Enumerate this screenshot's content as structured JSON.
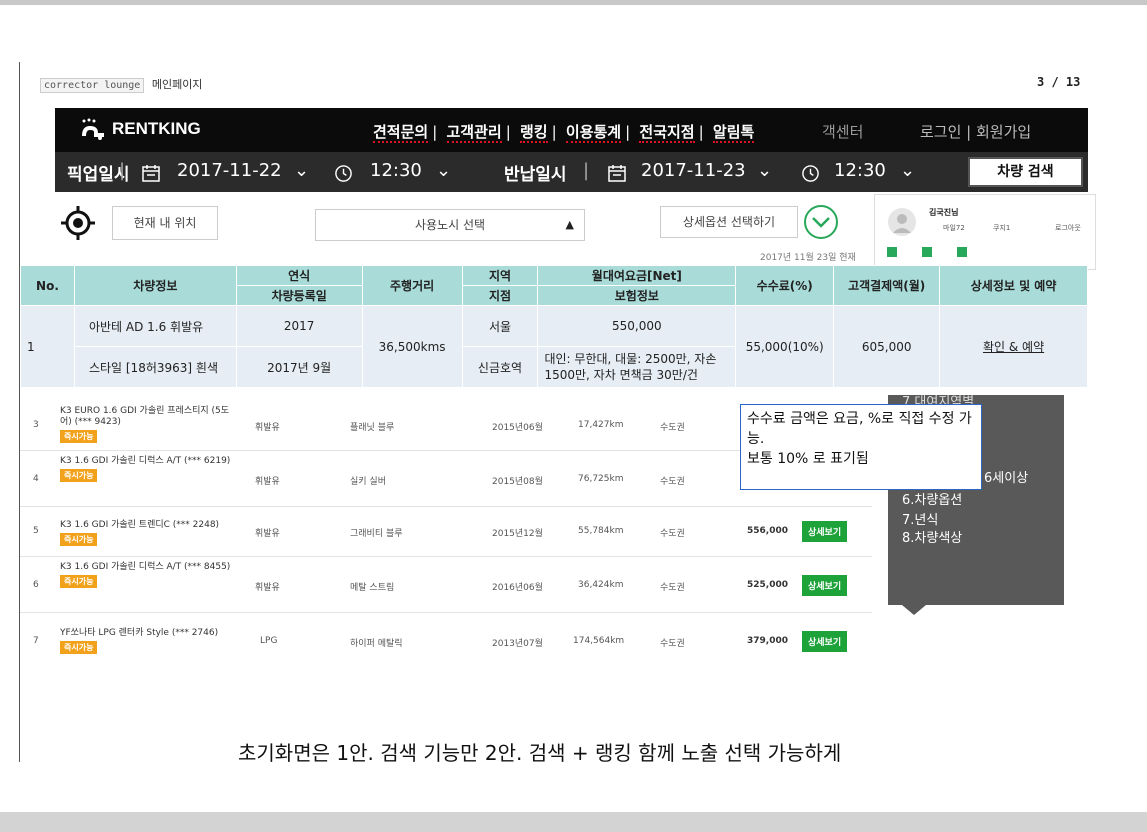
{
  "page": {
    "breadcrumb_tag": "corrector lounge",
    "breadcrumb_title": "메인페이지",
    "page_number": "3 / 13"
  },
  "nav": {
    "logo": "RENTKING",
    "menu": [
      "견적문의",
      "고객관리",
      "랭킹",
      "이용통계",
      "전국지점",
      "알림톡"
    ],
    "menu_partial": "객센터",
    "login": "로그인 | 회원가입"
  },
  "search": {
    "pickup_label": "픽업일시",
    "pickup_date": "2017-11-22",
    "pickup_time": "12:30",
    "return_label": "반납일시",
    "return_date": "2017-11-23",
    "return_time": "12:30",
    "search_button": "차량 검색",
    "current_location": "현재 내 위치",
    "region_select": "사용노시 선택",
    "option_select": "상세옵션 선택하기",
    "as_of_date": "2017년 11월 23일 현재"
  },
  "user": {
    "name": "김국진님",
    "points": "마일72",
    "coupon": "쿠지1",
    "logout": "로그아웃"
  },
  "table": {
    "headers": {
      "no": "No.",
      "car_info": "차량정보",
      "year": "연식",
      "reg_date": "차량등록일",
      "mileage": "주행거리",
      "region": "지역",
      "branch": "지점",
      "monthly_fee": "월대여요금[Net]",
      "insurance": "보험정보",
      "commission": "수수료(%)",
      "customer_pay": "고객결제액(월)",
      "detail": "상세정보 및 예약"
    },
    "row": {
      "no": "1",
      "car_name": "아반테 AD 1.6 휘발유",
      "car_detail": "스타일 [18허3963] 흰색",
      "year": "2017",
      "reg_date": "2017년 9월",
      "mileage": "36,500kms",
      "region": "서울",
      "branch": "신금호역",
      "monthly_fee": "550,000",
      "insurance": "대인: 무한대, 대물: 2500만, 자손 1500만, 자차 면책금 30만/건",
      "commission": "55,000(10%)",
      "customer_pay": "605,000",
      "detail_link": "확인 & 예약"
    }
  },
  "list": [
    {
      "no": "3",
      "title": "K3 EURO 1.6 GDI 가솔린 프레스티지 (5도어) (*** 9423)",
      "badge": "즉시가능",
      "fuel": "휘발유",
      "color": "플래닛 블루",
      "date": "2015년06월",
      "km": "17,427km",
      "area": "수도권",
      "price": "",
      "btn": ""
    },
    {
      "no": "4",
      "title": "K3 1.6 GDI 가솔린 디럭스 A/T (*** 6219)",
      "badge": "즉시가능",
      "fuel": "휘발유",
      "color": "실키 실버",
      "date": "2015년08월",
      "km": "76,725km",
      "area": "수도권",
      "price": "",
      "btn": ""
    },
    {
      "no": "5",
      "title": "K3 1.6 GDI 가솔린 트렌디C (*** 2248)",
      "badge": "즉시가능",
      "fuel": "휘발유",
      "color": "그래비티 블루",
      "date": "2015년12월",
      "km": "55,784km",
      "area": "수도권",
      "price": "556,000",
      "btn": "상세보기"
    },
    {
      "no": "6",
      "title": "K3 1.6 GDI 가솔린 디럭스 A/T (*** 8455)",
      "badge": "즉시가능",
      "fuel": "휘발유",
      "color": "메탈 스트림",
      "date": "2016년06월",
      "km": "36,424km",
      "area": "수도권",
      "price": "525,000",
      "btn": "상세보기"
    },
    {
      "no": "7",
      "title": "YF쏘나타 LPG 렌터카 Style (*** 2746)",
      "badge": "즉시가능",
      "fuel": "LPG",
      "color": "하이퍼 메탈릭",
      "date": "2013년07월",
      "km": "174,564km",
      "area": "수도권",
      "price": "379,000",
      "btn": "상세보기"
    }
  ],
  "panel": {
    "line1": "7.대여지역별",
    "line2": "6세이상",
    "line3": "6.차량옵션",
    "line4": "7.년식",
    "line5": "8.차량색상"
  },
  "note": "수수료 금액은 요금, %로 직접 수정 가능.\n보통 10% 로 표기됨",
  "caption": "초기화면은 1안. 검색 기능만  2안. 검색 + 랭킹 함께 노출  선택 가능하게"
}
